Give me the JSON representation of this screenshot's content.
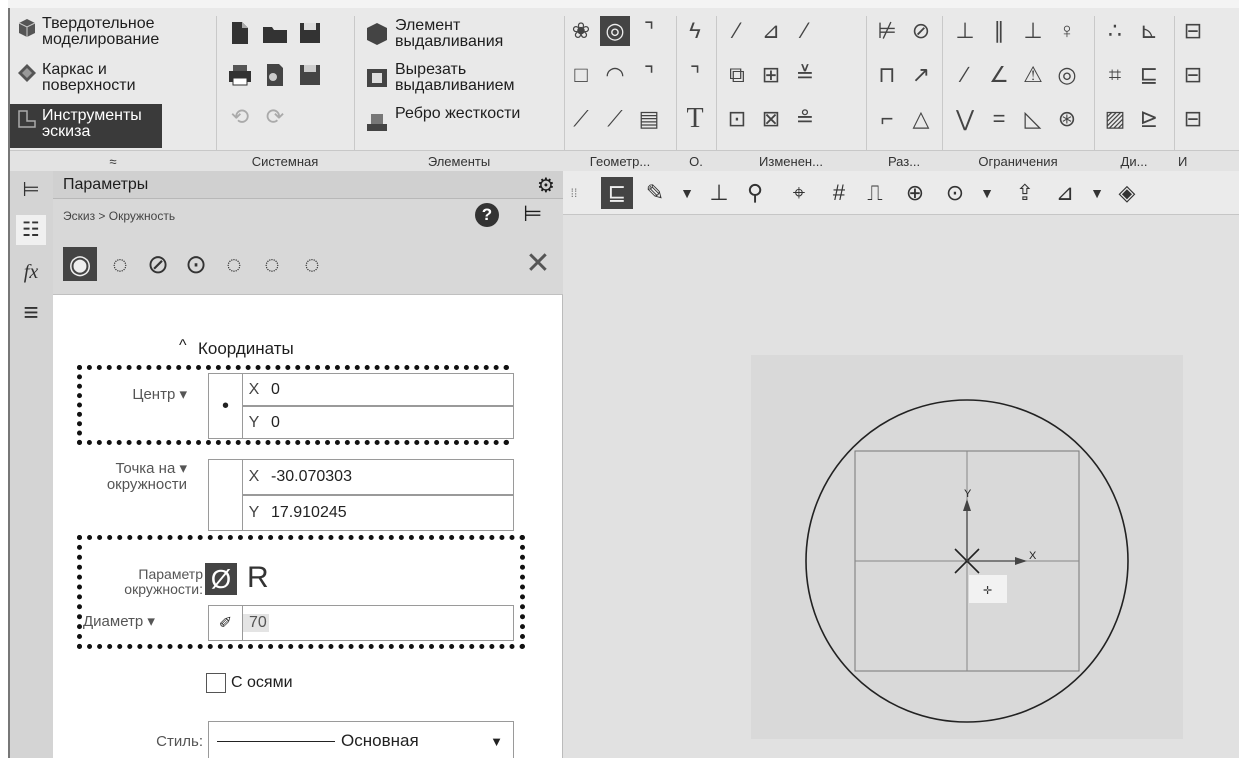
{
  "ribbon": {
    "categories": [
      {
        "label": "Твердотельное моделирование",
        "icon": "solid-cube-icon"
      },
      {
        "label": "Каркас и поверхности",
        "icon": "surface-icon"
      },
      {
        "label": "Инструменты эскиза",
        "icon": "sketch-icon",
        "selected": true
      }
    ],
    "expand_glyph": "≈",
    "elements": [
      {
        "label": "Элемент выдавливания",
        "icon": "extrude-icon"
      },
      {
        "label": "Вырезать выдавливанием",
        "icon": "cut-extrude-icon"
      },
      {
        "label": "Ребро жесткости",
        "icon": "rib-icon"
      }
    ],
    "groups": [
      {
        "label": "Системная"
      },
      {
        "label": "Элементы"
      },
      {
        "label": "Геометр..."
      },
      {
        "label": "О."
      },
      {
        "label": "Изменен..."
      },
      {
        "label": "Раз..."
      },
      {
        "label": "Ограничения"
      },
      {
        "label": "Ди..."
      },
      {
        "label": "И"
      }
    ]
  },
  "panel": {
    "title": "Параметры",
    "breadcrumb": "Эскиз > Окружность",
    "section_title": "Координаты",
    "center": {
      "label": "Центр",
      "x_axis": "X",
      "x": "0",
      "y_axis": "Y",
      "y": "0"
    },
    "point": {
      "label_line1": "Точка на",
      "label_line2": "окружности",
      "x_axis": "X",
      "x": "-30.070303",
      "y_axis": "Y",
      "y": "17.910245"
    },
    "circle_param": {
      "label_line1": "Параметр",
      "label_line2": "окружности:",
      "diameter_symbol": "Ø",
      "radius_symbol": "R"
    },
    "diameter": {
      "label": "Диаметр",
      "value": "70"
    },
    "axes_checkbox": {
      "label": "С осями",
      "checked": false
    },
    "style": {
      "label": "Стиль:",
      "value": "Основная"
    }
  },
  "viewport": {
    "axis_x": "X",
    "axis_y": "Y"
  }
}
